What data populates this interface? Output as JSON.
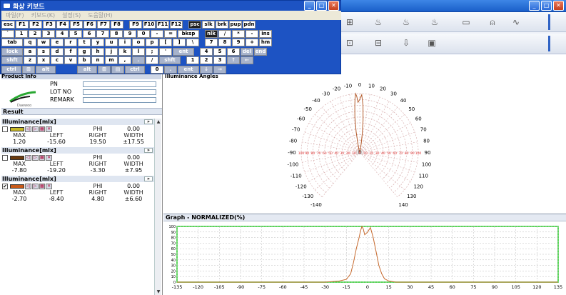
{
  "keyboard_window": {
    "title": "화상 키보드",
    "menu": [
      "파일(F)",
      "키보드(K)",
      "설정(S)",
      "도움말(H)"
    ],
    "rows": [
      [
        "esc",
        "F1",
        "F2",
        "F3",
        "F4",
        "F5",
        "F6",
        "F7",
        "F8",
        "",
        "F9",
        "F10",
        "F11",
        "F12",
        "",
        "psc",
        "slk",
        "brk",
        "pup",
        "pdn"
      ],
      [
        "`",
        "1",
        "2",
        "3",
        "4",
        "5",
        "6",
        "7",
        "8",
        "9",
        "0",
        "-",
        "=",
        "bksp",
        "",
        "nlk",
        "/",
        "*",
        "-",
        "ins"
      ],
      [
        "tab",
        "q",
        "w",
        "e",
        "r",
        "t",
        "y",
        "u",
        "i",
        "o",
        "p",
        "[",
        "]",
        "\\",
        "",
        "7",
        "8",
        "9",
        "+",
        "hm"
      ],
      [
        "lock",
        "a",
        "s",
        "d",
        "f",
        "g",
        "h",
        "j",
        "k",
        "l",
        ";",
        "'",
        "ent",
        "",
        "4",
        "5",
        "6",
        "del",
        "end"
      ],
      [
        "shft",
        "z",
        "x",
        "c",
        "v",
        "b",
        "n",
        "m",
        ",",
        ".",
        "/",
        "shft",
        "",
        "1",
        "2",
        "3",
        "↑",
        "←"
      ],
      [
        "ctrl",
        "⊞",
        "alt",
        "",
        "alt",
        "⊞",
        "▤",
        "ctrl",
        "",
        "0",
        ".",
        "ent",
        "↓",
        "→"
      ]
    ]
  },
  "main_window": {
    "win_buttons": [
      "_",
      "□",
      "✕"
    ]
  },
  "toolbar": {
    "row1_icons": [
      "sensor-icon",
      "lamp1-icon",
      "lamp2-icon",
      "lamp3-icon",
      "panel-icon",
      "tree-icon",
      "wave-icon"
    ],
    "row2_icons": [
      "folder-open-icon",
      "folder-save-icon",
      "download-icon",
      "screen-icon"
    ]
  },
  "product_info": {
    "header": "Product Info",
    "logo_text": "Daewoo",
    "fields": [
      {
        "label": "PN",
        "value": ""
      },
      {
        "label": "LOT NO",
        "value": ""
      },
      {
        "label": "REMARK",
        "value": ""
      }
    ]
  },
  "result": {
    "header": "Result",
    "measurements": [
      {
        "title": "Illuminance[mlx]",
        "checked": false,
        "color": "#c7b826",
        "phi_label": "PHI",
        "phi": "0.00",
        "cols": [
          "MAX",
          "LEFT",
          "RIGHT",
          "WIDTH"
        ],
        "vals": [
          "1.20",
          "-15.60",
          "19.50",
          "±17.55"
        ]
      },
      {
        "title": "Illuminance[mlx]",
        "checked": false,
        "color": "#6b3a0e",
        "phi_label": "PHI",
        "phi": "0.00",
        "cols": [
          "MAX",
          "LEFT",
          "RIGHT",
          "WIDTH"
        ],
        "vals": [
          "-7.80",
          "-19.20",
          "-3.30",
          "±7.95"
        ]
      },
      {
        "title": "Illuminance[mlx]",
        "checked": true,
        "color": "#c85a1a",
        "phi_label": "PHI",
        "phi": "0.00",
        "cols": [
          "MAX",
          "LEFT",
          "RIGHT",
          "WIDTH"
        ],
        "vals": [
          "-2.70",
          "-8.40",
          "4.80",
          "±6.60"
        ]
      }
    ]
  },
  "polar": {
    "header": "Illuminance Angles",
    "angle_labels": [
      "-140",
      "-130",
      "-120",
      "-110",
      "-100",
      "-90",
      "-80",
      "-70",
      "-60",
      "-50",
      "-40",
      "-30",
      "-20",
      "-10",
      "0",
      "10",
      "20",
      "30",
      "40",
      "50",
      "60",
      "70",
      "80",
      "90",
      "100",
      "110",
      "120",
      "130",
      "140"
    ],
    "radial_labels": [
      "100",
      "90",
      "80",
      "70",
      "60",
      "50",
      "40",
      "30",
      "20",
      "10",
      "0",
      "10",
      "20",
      "30",
      "40",
      "50",
      "60",
      "70",
      "80",
      "90",
      "100"
    ],
    "grid_color": "#d8b0b0",
    "curve_color": "#b35a2a"
  },
  "graph": {
    "header": "Graph - NORMALIZED(%)",
    "border_color": "#22cc22",
    "curve_color": "#c6692d"
  },
  "chart_data": {
    "type": "line",
    "title": "Graph - NORMALIZED(%)",
    "xlabel": "",
    "ylabel": "",
    "xlim": [
      -135,
      135
    ],
    "ylim": [
      0,
      100
    ],
    "xticks": [
      -135,
      -120,
      -105,
      -90,
      -75,
      -60,
      -45,
      -30,
      -15,
      0,
      15,
      30,
      45,
      60,
      75,
      90,
      105,
      120,
      135
    ],
    "yticks": [
      0,
      10,
      20,
      30,
      40,
      50,
      60,
      70,
      80,
      90,
      100
    ],
    "grid": true,
    "series": [
      {
        "x": [
          -135,
          -45,
          -30,
          -20,
          -15,
          -12,
          -10,
          -8,
          -6,
          -5,
          -4,
          -3,
          -2,
          0,
          2,
          4,
          6,
          8,
          10,
          12,
          15,
          20,
          25,
          30,
          45,
          135
        ],
        "y": [
          0,
          0,
          0,
          2,
          5,
          15,
          35,
          60,
          80,
          92,
          100,
          95,
          85,
          90,
          98,
          80,
          55,
          30,
          15,
          6,
          2,
          0,
          0,
          0,
          0,
          0
        ]
      }
    ]
  }
}
